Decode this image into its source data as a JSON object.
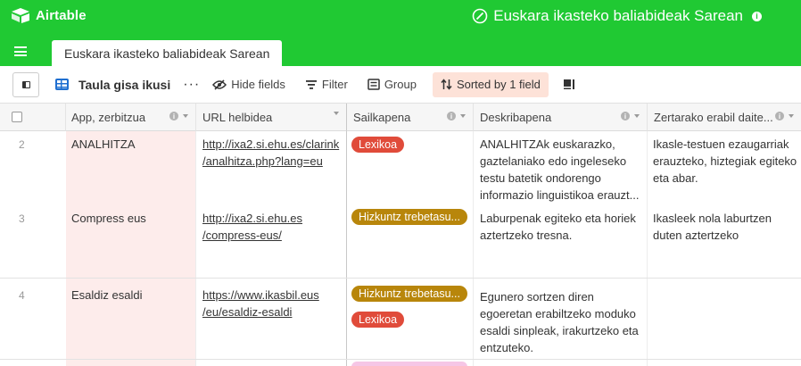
{
  "app": {
    "logo_text": "Airtable"
  },
  "base": {
    "title": "Euskara ikasteko baliabideak Sarean"
  },
  "tabs": [
    {
      "label": "Euskara ikasteko baliabideak Sarean"
    }
  ],
  "toolbar": {
    "view_name": "Taula gisa ikusi",
    "more": "···",
    "hide_fields": "Hide fields",
    "filter": "Filter",
    "group": "Group",
    "sorted": "Sorted by 1 field"
  },
  "columns": [
    {
      "label": "App, zerbitzua"
    },
    {
      "label": "URL helbidea"
    },
    {
      "label": "Sailkapena"
    },
    {
      "label": "Deskribapena"
    },
    {
      "label": "Zertarako erabil daite..."
    }
  ],
  "rows": [
    {
      "num": "2",
      "app": "ANALHITZA",
      "url_line1": "http://ixa2.si.ehu.es/clarink",
      "url_line2": "/analhitza.php?lang=eu",
      "tags": [
        "Lexikoa"
      ],
      "desc": [
        "ANALHITZAk euskarazko,",
        "gaztelaniako edo ingeleseko",
        "testu batetik ondorengo",
        "informazio linguistikoa erauzt..."
      ],
      "use": [
        "Ikasle-testuen ezaugarriak",
        "erauzteko, hiztegiak egiteko",
        "eta abar."
      ]
    },
    {
      "num": "3",
      "app": "Compress eus",
      "url_line1": "http://ixa2.si.ehu.es",
      "url_line2": "/compress-eus/",
      "tags": [
        "Hizkuntz trebetasu..."
      ],
      "desc": [
        "Laburpenak egiteko eta horiek",
        "aztertzeko tresna."
      ],
      "use": [
        "Ikasleek nola laburtzen",
        "duten aztertzeko"
      ]
    },
    {
      "num": "4",
      "app": "Esaldiz esaldi",
      "url_line1": "https://www.ikasbil.eus",
      "url_line2": "/eu/esaldiz-esaldi",
      "tags": [
        "Hizkuntz trebetasu...",
        "Lexikoa"
      ],
      "desc": [
        "Egunero sortzen diren",
        "egoeretan erabiltzeko moduko",
        "esaldi sinpleak, irakurtzeko eta",
        "entzuteko."
      ],
      "use": []
    }
  ],
  "colors": {
    "brand": "#20c933",
    "tag_red": "#e04b3a",
    "tag_gold": "#b8860b",
    "sorted_bg": "#fde2d8"
  }
}
